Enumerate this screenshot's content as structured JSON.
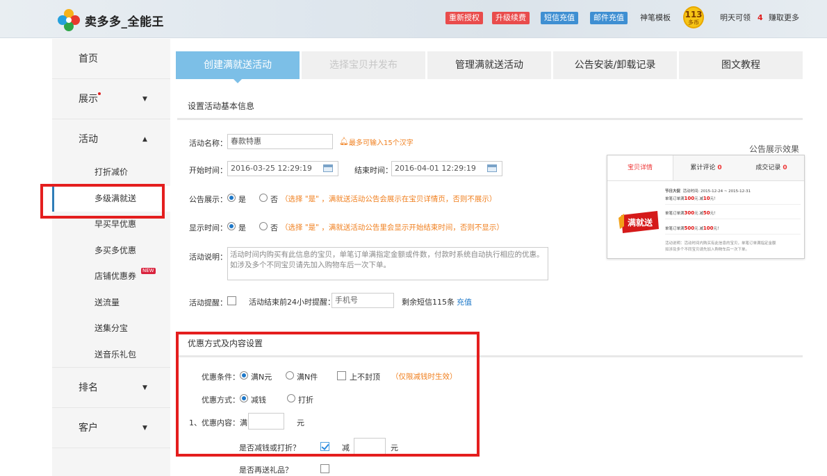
{
  "header": {
    "logo_text": "卖多多_全能王",
    "buttons": [
      {
        "label": "重新授权",
        "color": "#e94c4c"
      },
      {
        "label": "升级续费",
        "color": "#e94c4c"
      },
      {
        "label": "短信充值",
        "color": "#3f8fd2"
      },
      {
        "label": "邮件充值",
        "color": "#3f8fd2"
      }
    ],
    "template_link": "神笔模板",
    "coin_value": "113",
    "coin_unit": "多币",
    "tomorrow_label": "明天可领",
    "tomorrow_count": "4",
    "earn_more": "赚取更多"
  },
  "sidebar": {
    "home": "首页",
    "display": "展示",
    "activity": "活动",
    "sub_items": [
      "打折减价",
      "多级满就送",
      "早买早优惠",
      "多买多优惠",
      "店铺优惠券",
      "送流量",
      "送集分宝",
      "送音乐礼包"
    ],
    "new_tag": "NEW",
    "ranking": "排名",
    "customer": "客户"
  },
  "tabs": [
    {
      "label": "创建满就送活动",
      "state": "active"
    },
    {
      "label": "选择宝贝并发布",
      "state": "disabled"
    },
    {
      "label": "管理满就送活动",
      "state": "normal"
    },
    {
      "label": "公告安装/卸载记录",
      "state": "normal"
    },
    {
      "label": "图文教程",
      "state": "normal"
    }
  ],
  "basic": {
    "section_title": "设置活动基本信息",
    "name_label": "活动名称：",
    "name_value": "春款特惠",
    "name_hint": "最多可输入15个汉字",
    "start_label": "开始时间：",
    "start_value": "2016-03-25 12:29:19",
    "end_label": "结束时间：",
    "end_value": "2016-04-01 12:29:19",
    "notice_label": "公告展示：",
    "yes": "是",
    "no": "否",
    "notice_hint": "（选择 \"是\" ，满就送活动公告会展示在宝贝详情页，否则不展示）",
    "showtime_label": "显示时间：",
    "showtime_hint": "（选择 \"是\" ，满就送活动公告里会显示开始结束时间，否则不显示）",
    "desc_label": "活动说明：",
    "desc_value": "活动时间内购买有此信息的宝贝，单笔订单满指定金额或件数，付款时系统自动执行相应的优惠。如涉及多个不同宝贝请先加入购物车后一次下单。",
    "remind_label": "活动提醒：",
    "remind_text": "活动结束前24小时提醒：",
    "phone_placeholder": "手机号",
    "sms_left": "剩余短信115条",
    "recharge": "充值"
  },
  "discount": {
    "section_title": "优惠方式及内容设置",
    "cond_label": "优惠条件：",
    "cond_opt1": "满N元",
    "cond_opt2": "满N件",
    "cap_label": "上不封顶",
    "cap_hint": "（仅限减钱时生效）",
    "method_label": "优惠方式：",
    "method_opt1": "减钱",
    "method_opt2": "打折",
    "content_label": "1、优惠内容：满",
    "yuan": "元",
    "reduce_q": "是否减钱或打折？",
    "reduce": "减",
    "gift_q": "是否再送礼品？"
  },
  "preview": {
    "title": "公告展示效果",
    "tabs": [
      "宝贝详情",
      "累计评论",
      "成交记录"
    ],
    "review_count": "0",
    "deal_count": "0",
    "badge": "满就送",
    "event_title": "节日大促",
    "event_time": "活动时间: 2015-12-24 ~ 2015-12-31",
    "rules": [
      {
        "pre": "单笔订单满",
        "amount": "100",
        "mid": "元 减",
        "cut": "10",
        "post": "元！"
      },
      {
        "pre": "单笔订单满",
        "amount": "300",
        "mid": "元 减",
        "cut": "50",
        "post": "元！"
      },
      {
        "pre": "单笔订单满",
        "amount": "500",
        "mid": "元 减",
        "cut": "100",
        "post": "元！"
      }
    ],
    "note": "活动说明：活动时间内购买有此信息的宝贝，单笔订单满指定金额",
    "note2": "如涉及多个不同宝贝请先加入购物车后一次下单。"
  },
  "colors": {
    "tab_active": "#7cbfe7",
    "highlight": "#e41e1e",
    "hint_orange": "#f08020",
    "link_blue": "#1e78c8"
  }
}
